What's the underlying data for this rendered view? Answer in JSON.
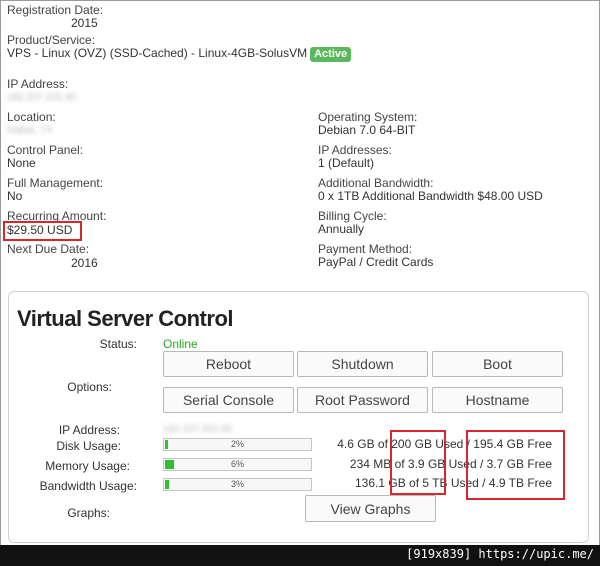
{
  "details": {
    "registration_date_label": "Registration Date:",
    "registration_date_value": "2015",
    "product_label": "Product/Service:",
    "product_value": "VPS - Linux (OVZ) (SSD-Cached) - Linux-4GB-SolusVM",
    "status_badge": "Active",
    "ip_label": "IP Address:",
    "ip_value_blurred": "192.227.201.90",
    "location_label": "Location:",
    "location_value_blurred": "Dallas, TX",
    "control_panel_label": "Control Panel:",
    "control_panel_value": "None",
    "full_mgmt_label": "Full Management:",
    "full_mgmt_value": "No",
    "recurring_label": "Recurring Amount:",
    "recurring_value": "$29.50 USD",
    "next_due_label": "Next Due Date:",
    "next_due_value": "2016",
    "os_label": "Operating System:",
    "os_value": "Debian 7.0 64-BIT",
    "ips_label": "IP Addresses:",
    "ips_value": "1 (Default)",
    "bandwidth_label": "Additional Bandwidth:",
    "bandwidth_value": "0 x 1TB Additional Bandwidth $48.00 USD",
    "billing_label": "Billing Cycle:",
    "billing_value": "Annually",
    "payment_label": "Payment Method:",
    "payment_value": "PayPal / Credit Cards"
  },
  "vsc": {
    "title": "Virtual Server Control",
    "status_label": "Status:",
    "status_value": "Online",
    "options_label": "Options:",
    "buttons": {
      "reboot": "Reboot",
      "shutdown": "Shutdown",
      "boot": "Boot",
      "serial_console": "Serial Console",
      "root_password": "Root Password",
      "hostname": "Hostname",
      "view_graphs": "View Graphs"
    },
    "ip_label": "IP Address:",
    "ip_value_blurred": "192.227.201.90",
    "disk_label": "Disk Usage:",
    "disk_pct_text": "2%",
    "disk_fraction": 0.02,
    "disk_usage": "4.6 GB of 200 GB Used / 195.4 GB Free",
    "memory_label": "Memory Usage:",
    "memory_pct_text": "6%",
    "memory_fraction": 0.06,
    "memory_usage": "234 MB of 3.9 GB Used / 3.7 GB Free",
    "bw_label": "Bandwidth Usage:",
    "bw_pct_text": "3%",
    "bw_fraction": 0.03,
    "bw_usage": "136.1 GB of 5 TB Used / 4.9 TB Free",
    "graphs_label": "Graphs:"
  },
  "watermark": "[919x839] https://upic.me/",
  "colors": {
    "online": "#22aa22",
    "active_badge": "#5cb85c",
    "annotation_red": "#d9262c",
    "bar_fill": "#2ec12e"
  }
}
